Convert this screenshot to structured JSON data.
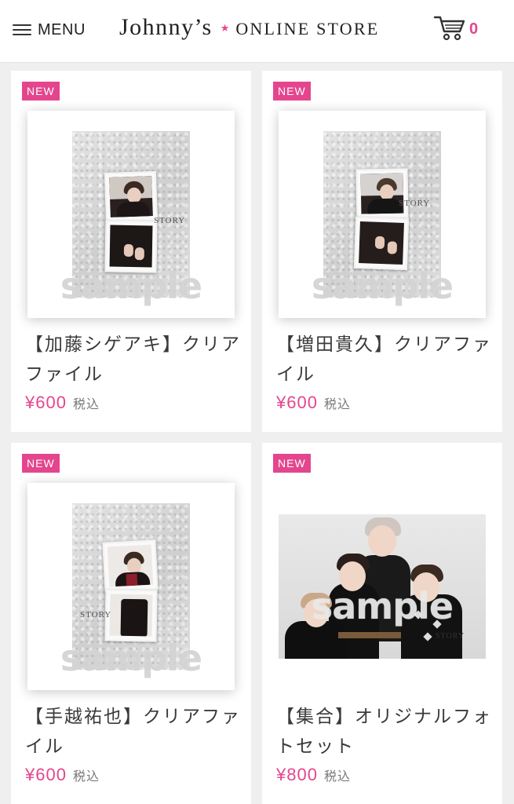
{
  "header": {
    "menu_label": "MENU",
    "brand_name": "Johnny’s",
    "brand_star": "★",
    "brand_store": "ONLINE STORE",
    "cart_count": "0"
  },
  "products": [
    {
      "badge": "NEW",
      "title": "【加藤シゲアキ】クリアファイル",
      "price": "¥600",
      "tax": "税込",
      "watermark": "sample",
      "image": "clear-file"
    },
    {
      "badge": "NEW",
      "title": "【増田貴久】クリアファイル",
      "price": "¥600",
      "tax": "税込",
      "watermark": "sample",
      "image": "clear-file"
    },
    {
      "badge": "NEW",
      "title": "【手越祐也】クリアファイル",
      "price": "¥600",
      "tax": "税込",
      "watermark": "sample",
      "image": "clear-file"
    },
    {
      "badge": "NEW",
      "title": "【集合】オリジナルフォトセット",
      "price": "¥800",
      "tax": "税込",
      "watermark": "sample",
      "image": "group-photo"
    }
  ],
  "colors": {
    "accent": "#e4468e",
    "background": "#efefef",
    "card": "#ffffff"
  }
}
